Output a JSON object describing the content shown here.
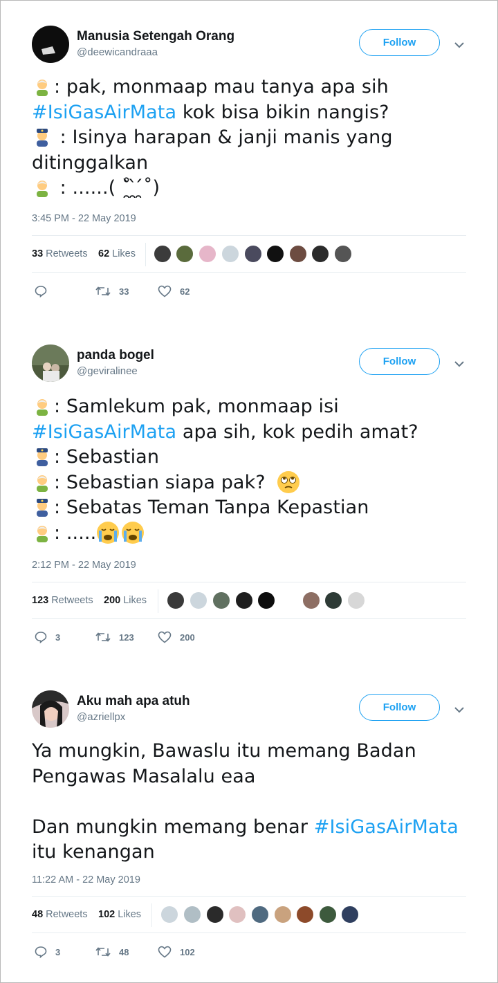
{
  "follow_label": "Follow",
  "tweets": [
    {
      "name": "Manusia Setengah Orang",
      "handle": "@deewicandraaa",
      "time": "3:45 PM - 22 May 2019",
      "retweets": "33",
      "retweets_label": "Retweets",
      "likes": "62",
      "likes_label": "Likes",
      "reply_count": "",
      "retweet_count": "33",
      "like_count": "62",
      "lines": [
        {
          "emoji": "old-man-emoji",
          "pre": ": pak, monmaap mau tanya apa sih",
          "tag": "",
          "post": ""
        },
        {
          "emoji": "",
          "pre": "",
          "tag": "#IsiGasAirMata",
          "post": " kok bisa bikin nangis?"
        },
        {
          "emoji": "police-officer-emoji",
          "pre": " : Isinya harapan & janji manis yang",
          "tag": "",
          "post": ""
        },
        {
          "emoji": "",
          "pre": "ditinggalkan",
          "tag": "",
          "post": ""
        },
        {
          "emoji": "old-man-emoji",
          "pre": " : ......( ˚̯̀ ̯̀ ̯́˚)",
          "tag": "",
          "post": ""
        }
      ]
    },
    {
      "name": "panda bogel",
      "handle": "@geviralinee",
      "time": "2:12 PM - 22 May 2019",
      "retweets": "123",
      "retweets_label": "Retweets",
      "likes": "200",
      "likes_label": "Likes",
      "reply_count": "3",
      "retweet_count": "123",
      "like_count": "200",
      "lines": [
        {
          "emoji": "old-man-emoji",
          "pre": ": Samlekum pak, monmaap isi",
          "tag": "",
          "post": ""
        },
        {
          "emoji": "",
          "pre": "",
          "tag": "#IsiGasAirMata",
          "post": " apa sih, kok pedih amat?"
        },
        {
          "emoji": "police-officer-emoji",
          "pre": ": Sebastian",
          "tag": "",
          "post": ""
        },
        {
          "emoji": "old-man-emoji",
          "pre": ": Sebastian siapa pak?",
          "tag": "",
          "post": ""
        },
        {
          "emoji": "police-officer-emoji",
          "pre": ": Sebatas Teman Tanpa Kepastian",
          "tag": "",
          "post": ""
        },
        {
          "emoji": "old-man-emoji",
          "pre": ": .....",
          "tag": "",
          "post": ""
        }
      ]
    },
    {
      "name": "Aku mah apa atuh",
      "handle": "@azriellpx",
      "time": "11:22 AM - 22 May 2019",
      "retweets": "48",
      "retweets_label": "Retweets",
      "likes": "102",
      "likes_label": "Likes",
      "reply_count": "3",
      "retweet_count": "48",
      "like_count": "102",
      "lines": [
        {
          "emoji": "",
          "pre": "Ya mungkin, Bawaslu itu memang Badan",
          "tag": "",
          "post": ""
        },
        {
          "emoji": "",
          "pre": "Pengawas Masalalu eaa",
          "tag": "",
          "post": ""
        },
        {
          "emoji": "",
          "pre": "",
          "tag": "",
          "post": "",
          "blank": true
        },
        {
          "emoji": "",
          "pre": "Dan mungkin memang benar ",
          "tag": "#IsiGasAirMata",
          "post": ""
        },
        {
          "emoji": "",
          "pre": "itu kenangan",
          "tag": "",
          "post": ""
        }
      ]
    }
  ],
  "colors": {
    "accent": "#1da1f2",
    "muted": "#657786",
    "text": "#14171a",
    "border": "#e6ecf0"
  }
}
